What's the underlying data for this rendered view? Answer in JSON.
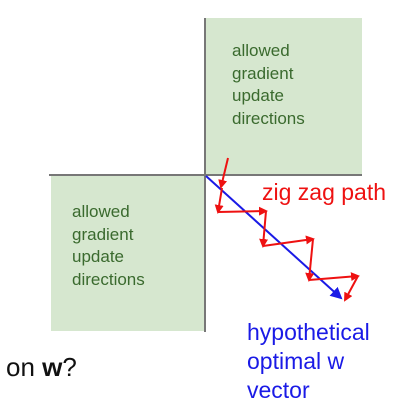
{
  "regions": {
    "upper_right": {
      "lines": [
        "allowed",
        "gradient",
        "update",
        "directions"
      ]
    },
    "lower_left": {
      "lines": [
        "allowed",
        "gradient",
        "update",
        "directions"
      ]
    }
  },
  "labels": {
    "zigzag": "zig zag path",
    "optimal": [
      "hypothetical",
      "optimal w",
      "vector"
    ]
  },
  "question": {
    "prefix": "on ",
    "bold": "w",
    "suffix": "?"
  },
  "colors": {
    "region_fill": "#d6e7cf",
    "region_text": "#3a6a2e",
    "axes": "#777777",
    "zigzag": "#ee1111",
    "optimal": "#1a1ae6"
  }
}
